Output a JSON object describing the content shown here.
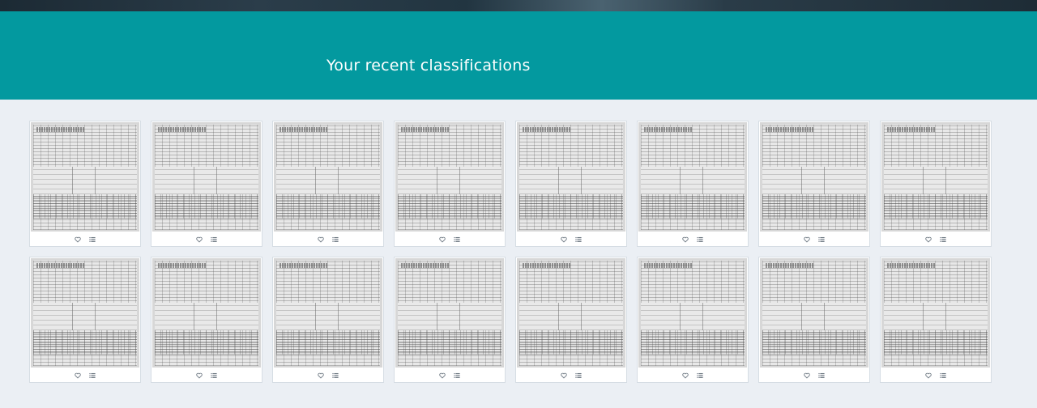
{
  "banner": {
    "title": "Your recent classifications",
    "color": "#03999f"
  },
  "classifications": {
    "rows": 2,
    "columns": 8,
    "items": [
      {
        "thumbnail": "scanned-form-thumbnail",
        "actions": [
          "heart-icon",
          "collection-list-icon"
        ]
      },
      {
        "thumbnail": "scanned-form-thumbnail",
        "actions": [
          "heart-icon",
          "collection-list-icon"
        ]
      },
      {
        "thumbnail": "scanned-form-thumbnail",
        "actions": [
          "heart-icon",
          "collection-list-icon"
        ]
      },
      {
        "thumbnail": "scanned-form-thumbnail",
        "actions": [
          "heart-icon",
          "collection-list-icon"
        ]
      },
      {
        "thumbnail": "scanned-form-thumbnail",
        "actions": [
          "heart-icon",
          "collection-list-icon"
        ]
      },
      {
        "thumbnail": "scanned-form-thumbnail",
        "actions": [
          "heart-icon",
          "collection-list-icon"
        ]
      },
      {
        "thumbnail": "scanned-form-thumbnail",
        "actions": [
          "heart-icon",
          "collection-list-icon"
        ]
      },
      {
        "thumbnail": "scanned-form-thumbnail",
        "actions": [
          "heart-icon",
          "collection-list-icon"
        ]
      },
      {
        "thumbnail": "scanned-form-thumbnail",
        "actions": [
          "heart-icon",
          "collection-list-icon"
        ]
      },
      {
        "thumbnail": "scanned-form-thumbnail",
        "actions": [
          "heart-icon",
          "collection-list-icon"
        ]
      },
      {
        "thumbnail": "scanned-form-thumbnail",
        "actions": [
          "heart-icon",
          "collection-list-icon"
        ]
      },
      {
        "thumbnail": "scanned-form-thumbnail",
        "actions": [
          "heart-icon",
          "collection-list-icon"
        ]
      },
      {
        "thumbnail": "scanned-form-thumbnail",
        "actions": [
          "heart-icon",
          "collection-list-icon"
        ]
      },
      {
        "thumbnail": "scanned-form-thumbnail",
        "actions": [
          "heart-icon",
          "collection-list-icon"
        ]
      },
      {
        "thumbnail": "scanned-form-thumbnail",
        "actions": [
          "heart-icon",
          "collection-list-icon"
        ]
      },
      {
        "thumbnail": "scanned-form-thumbnail",
        "actions": [
          "heart-icon",
          "collection-list-icon"
        ]
      }
    ]
  },
  "colors": {
    "page_background": "#ebeff4",
    "card_background": "#ffffff",
    "icon_color": "#6b7680"
  }
}
